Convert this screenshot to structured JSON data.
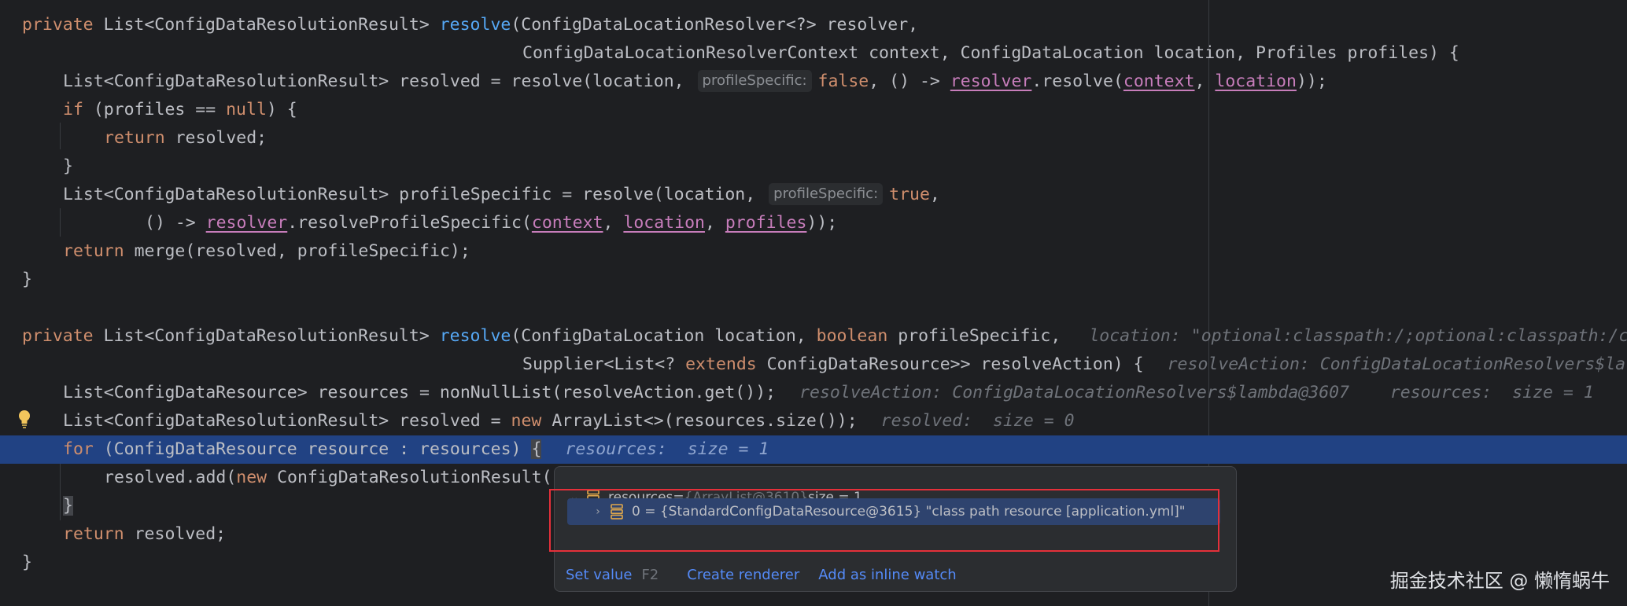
{
  "code": {
    "l1": {
      "kw": "private",
      "t1": " List<ConfigDataResolutionResult> ",
      "fn": "resolve",
      "t2": "(ConfigDataLocationResolver<?> resolver,"
    },
    "l2": {
      "t": "ConfigDataLocationResolverContext context, ConfigDataLocation location, Profiles profiles) {"
    },
    "l3": {
      "t1": "List<ConfigDataResolutionResult> resolved = resolve(location, ",
      "hint": "profileSpecific:",
      "kw": "false",
      "t2": ", () -> ",
      "p1": "resolver",
      "t3": ".resolve(",
      "p2": "context",
      "t4": ", ",
      "p3": "location",
      "t5": "));"
    },
    "l4": {
      "kw": "if",
      "t1": " (profiles == ",
      "kw2": "null",
      "t2": ") {"
    },
    "l5": {
      "kw": "return",
      "t": " resolved;"
    },
    "l6": {
      "t": "}"
    },
    "l7": {
      "t1": "List<ConfigDataResolutionResult> profileSpecific = resolve(location, ",
      "hint": "profileSpecific:",
      "kw": "true",
      "t2": ","
    },
    "l8": {
      "t1": "() -> ",
      "p1": "resolver",
      "t2": ".resolveProfileSpecific(",
      "p2": "context",
      "t3": ", ",
      "p3": "location",
      "t4": ", ",
      "p4": "profiles",
      "t5": "));"
    },
    "l9": {
      "kw": "return",
      "t": " merge(resolved, profileSpecific);"
    },
    "l10": {
      "t": "}"
    },
    "l11": {
      "kw": "private",
      "t1": " List<ConfigDataResolutionResult> ",
      "fn": "resolve",
      "t2": "(ConfigDataLocation location, ",
      "kw2": "boolean",
      "t3": " profileSpecific,",
      "dbg": "location: \"optional:classpath:/;optional:classpath:/c"
    },
    "l12": {
      "t1": "Supplier<List<? ",
      "kw": "extends",
      "t2": " ConfigDataResource>> resolveAction) {",
      "dbg": "resolveAction: ConfigDataLocationResolvers$la"
    },
    "l13": {
      "t": "List<ConfigDataResource> resources = nonNullList(resolveAction.get());",
      "dbg": "resolveAction: ConfigDataLocationResolvers$lambda@3607    resources:  size = 1"
    },
    "l14": {
      "t1": "List<ConfigDataResolutionResult> resolved = ",
      "kw": "new",
      "t2": " ArrayList<>(resources.size());",
      "dbg": "resolved:  size = 0"
    },
    "l15": {
      "kw": "for",
      "t1": " (ConfigDataResource resource : resources) ",
      "brace": "{",
      "dbg": "resources:  size = 1"
    },
    "l16": {
      "t1": "resolved.add(",
      "kw": "new",
      "t2": " ConfigDataResolutionResult("
    },
    "l17": {
      "t": "}"
    },
    "l18": {
      "kw": "return",
      "t": " resolved;"
    },
    "l19": {
      "t": "}"
    }
  },
  "popup": {
    "root": {
      "name": "resources",
      "eq": " = ",
      "type": "{ArrayList@3610}",
      "size": "  size = 1"
    },
    "item": {
      "text": "0 = {StandardConfigDataResource@3615} \"class path resource [application.yml]\""
    },
    "actions": {
      "set_value": "Set value",
      "set_value_key": "F2",
      "create_renderer": "Create renderer",
      "add_inline_watch": "Add as inline watch"
    }
  },
  "watermark": "掘金技术社区 @ 懒惰蜗牛",
  "colors": {
    "highlight": "#214283",
    "keyword": "#cf8e6d",
    "function": "#56a8f5",
    "parameter": "#c77dbb",
    "annotation_box": "#e5303a",
    "link": "#548af7"
  }
}
